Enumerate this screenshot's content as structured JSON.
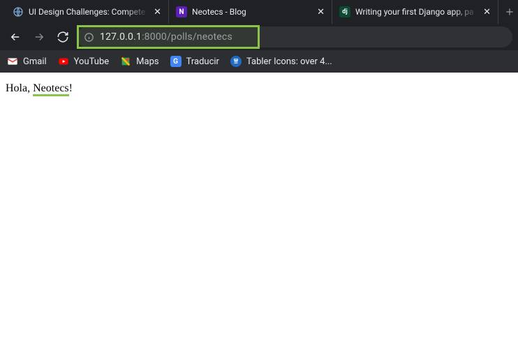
{
  "tabs": [
    {
      "title": "UI Design Challenges: Compete"
    },
    {
      "title": "Neotecs - Blog"
    },
    {
      "title": "Writing your first Django app, pa"
    }
  ],
  "url": {
    "host": "127.0.0.1",
    "rest": ":8000/polls/neotecs"
  },
  "bookmarks": {
    "gmail": "Gmail",
    "youtube": "YouTube",
    "maps": "Maps",
    "traducir": "Traducir",
    "tabler": "Tabler Icons: over 4..."
  },
  "page": {
    "greeting_prefix": "Hola, ",
    "greeting_name": "Neotecs",
    "greeting_suffix": "!"
  },
  "icons": {
    "dj_label": "dj",
    "n_label": "N"
  }
}
